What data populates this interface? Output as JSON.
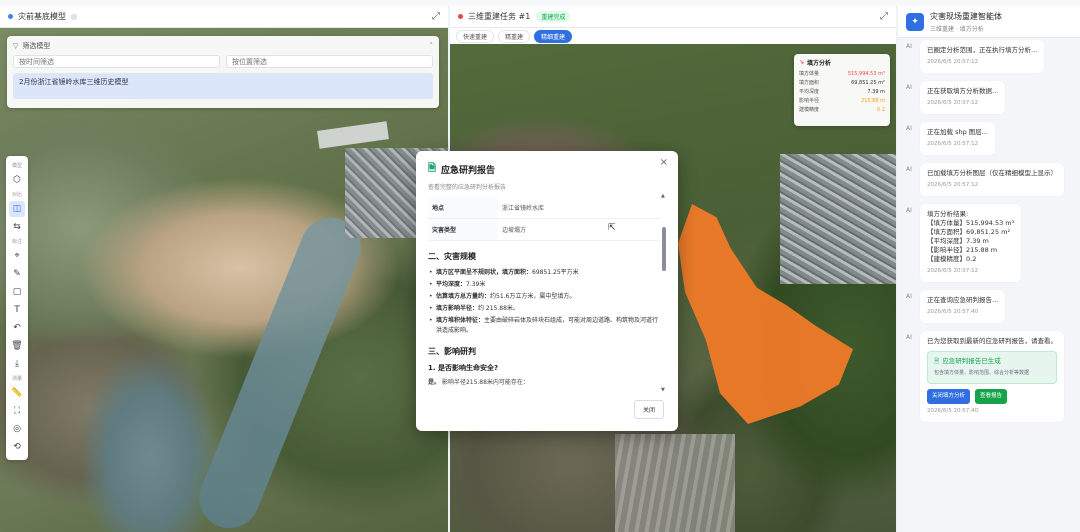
{
  "left_panel": {
    "title": "灾前基底模型",
    "filter": {
      "label": "筛选模型",
      "time_placeholder": "按时间筛选",
      "location_placeholder": "按位置筛选",
      "result": "2月份浙江省镜岭水库三维历史模型"
    },
    "toolbar": {
      "group1": "模型",
      "group2": "对比",
      "group3": "标注",
      "group4": "测量"
    }
  },
  "mid_panel": {
    "title": "三维重建任务 #1",
    "badge": "重建完成",
    "tabs": [
      {
        "label": "快速重建",
        "active": false
      },
      {
        "label": "精重建",
        "active": false
      },
      {
        "label": "精细重建",
        "active": true
      }
    ],
    "volume_card": {
      "title": "填方分析",
      "rows": [
        {
          "label": "填方体量",
          "value": "515,994.53 m³",
          "color": "red"
        },
        {
          "label": "填方面积",
          "value": "69,851.25 m²",
          "color": "normal"
        },
        {
          "label": "平均深度",
          "value": "7.39 m",
          "color": "normal"
        },
        {
          "label": "影响半径",
          "value": "215.88 m",
          "color": "orange"
        },
        {
          "label": "建模精度",
          "value": "0.2",
          "color": "orange"
        }
      ]
    }
  },
  "modal": {
    "title": "应急研判报告",
    "subtitle": "查看完整的应急研判分析报告",
    "info": [
      {
        "k": "地点",
        "v": "浙江省镜岭水库"
      },
      {
        "k": "灾害类型",
        "v": "边坡塌方"
      }
    ],
    "section2": "二、灾害规模",
    "bullets": [
      {
        "b": "填方区平面呈不规则状，填方面积：",
        "t": "69851.25平方米"
      },
      {
        "b": "平均深度：",
        "t": "7.39米"
      },
      {
        "b": "估算填方总方量约：",
        "t": "约51.6万立方米，属中型填方。"
      },
      {
        "b": "填方影响半径：",
        "t": "约 215.88米。"
      },
      {
        "b": "填方堆积体特征：",
        "t": "主要由破碎岩体及碎块石组成，可能对周边道路、构筑物及河道行洪造成影响。"
      }
    ],
    "section3": "三、影响研判",
    "q1": "1. 是否影响生命安全?",
    "a1_bold": "是。",
    "a1": "影响半径215.88米内可能存在：",
    "close_label": "关闭"
  },
  "right_panel": {
    "title": "灾害现场重建智能体",
    "subtitle": "三维重建 · 填方分析",
    "messages": [
      {
        "text": "已圈定分析范围，正在执行填方分析...",
        "ts": "2026/6/5 20:57:12"
      },
      {
        "text": "正在获取填方分析数据...",
        "ts": "2026/6/5 20:57:12"
      },
      {
        "text": "正在加载 shp 图层...",
        "ts": "2026/6/5 20:57:12"
      },
      {
        "text": "已加载填方分析图层（仅在精细模型上显示）",
        "ts": "2026/6/5 20:57:12"
      },
      {
        "text": "填方分析结果:",
        "lines": [
          "【填方体量】515,994.53 m³",
          "【填方面积】69,851.25 m²",
          "【平均深度】7.39 m",
          "【影响半径】215.88 m",
          "【建模精度】0.2"
        ],
        "ts": "2026/6/5 20:57:12"
      },
      {
        "text": "正在查询应急研判报告...",
        "ts": "2026/6/5 20:57:40"
      },
      {
        "text": "已为您获取到最新的应急研判报告，请查看。",
        "card_title": "应急研判报告已生成",
        "card_sub": "包含填方体量、影响范围、综合分析等数据",
        "btn1": "关闭填方分析",
        "btn2": "查看报告",
        "ts": "2026/6/5 20:57:40"
      }
    ]
  },
  "colors": {
    "accent": "#2f6fe0",
    "landslide": "#ef7a28",
    "success": "#16a34a"
  }
}
